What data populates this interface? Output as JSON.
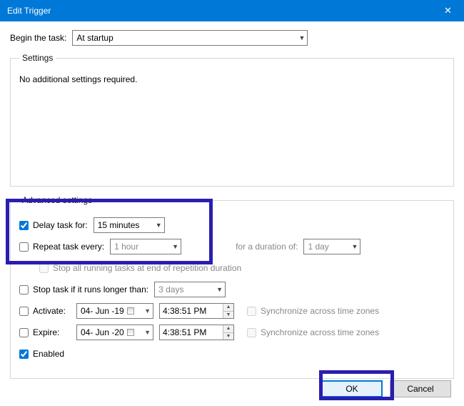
{
  "window": {
    "title": "Edit Trigger",
    "close_glyph": "✕"
  },
  "begin": {
    "label": "Begin the task:",
    "value": "At startup"
  },
  "settings": {
    "legend": "Settings",
    "message": "No additional settings required."
  },
  "advanced": {
    "legend": "Advanced settings",
    "delay": {
      "checked": true,
      "label": "Delay task for:",
      "value": "15 minutes"
    },
    "repeat": {
      "checked": false,
      "label": "Repeat task every:",
      "value": "1 hour",
      "duration_label": "for a duration of:",
      "duration_value": "1 day"
    },
    "stop_end": {
      "checked": false,
      "label": "Stop all running tasks at end of repetition duration"
    },
    "stop_long": {
      "checked": false,
      "label": "Stop task if it runs longer than:",
      "value": "3 days"
    },
    "activate": {
      "checked": false,
      "label": "Activate:",
      "date": "04- Jun -19",
      "time": "4:38:51 PM",
      "sync_label": "Synchronize across time zones",
      "sync_checked": false
    },
    "expire": {
      "checked": false,
      "label": "Expire:",
      "date": "04- Jun -20",
      "time": "4:38:51 PM",
      "sync_label": "Synchronize across time zones",
      "sync_checked": false
    },
    "enabled": {
      "checked": true,
      "label": "Enabled"
    }
  },
  "footer": {
    "ok": "OK",
    "cancel": "Cancel"
  },
  "colors": {
    "accent": "#0078d7",
    "highlight": "#2a1eb0"
  }
}
